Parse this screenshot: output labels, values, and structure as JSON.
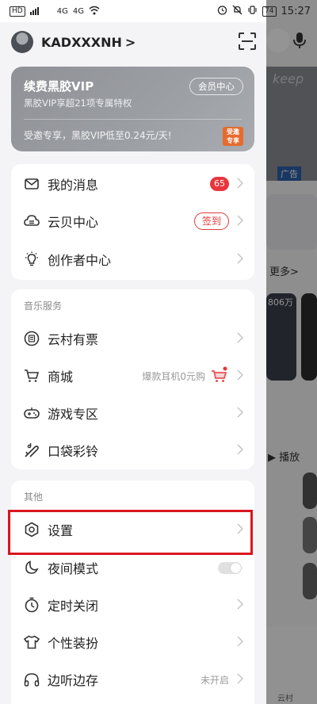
{
  "status_bar": {
    "left_chips": [
      "HD",
      "4G",
      "4G"
    ],
    "battery": "74",
    "time": "15:27"
  },
  "profile": {
    "username": "KADXXXNH",
    "chevron": ">"
  },
  "vip_card": {
    "title": "续费黑胶VIP",
    "subtitle": "黑胶VIP享超21项专属特权",
    "center_button": "会员中心",
    "promo": "受邀专享，黑胶VIP低至0.24元/天!",
    "badge_line1": "受邀",
    "badge_line2": "专享"
  },
  "card_main": {
    "items": [
      {
        "label": "我的消息",
        "icon": "mail-icon",
        "badge": "65"
      },
      {
        "label": "云贝中心",
        "icon": "cloud-coin-icon",
        "action": "签到"
      },
      {
        "label": "创作者中心",
        "icon": "lightbulb-icon"
      }
    ]
  },
  "card_music": {
    "title": "音乐服务",
    "items": [
      {
        "label": "云村有票",
        "icon": "ticket-icon"
      },
      {
        "label": "商城",
        "icon": "cart-icon",
        "hint": "爆款耳机0元购"
      },
      {
        "label": "游戏专区",
        "icon": "gamepad-icon"
      },
      {
        "label": "口袋彩铃",
        "icon": "ringtone-icon"
      }
    ]
  },
  "card_other": {
    "title": "其他",
    "items": [
      {
        "label": "设置",
        "icon": "settings-icon"
      },
      {
        "label": "夜间模式",
        "icon": "moon-icon",
        "toggle": "off"
      },
      {
        "label": "定时关闭",
        "icon": "timer-icon"
      },
      {
        "label": "个性装扮",
        "icon": "tshirt-icon"
      },
      {
        "label": "边听边存",
        "icon": "headphones-icon",
        "hint": "未开启"
      }
    ]
  },
  "background": {
    "banner_text": "keep",
    "ad_label": "广告",
    "more_label": "更多>",
    "play_label": "▶ 播放",
    "tab_label": "云村",
    "stat_text": "806万"
  },
  "colors": {
    "accent_red": "#e8363c",
    "vip_gray": "#9b9ea3",
    "highlight_red": "#d9161e"
  }
}
